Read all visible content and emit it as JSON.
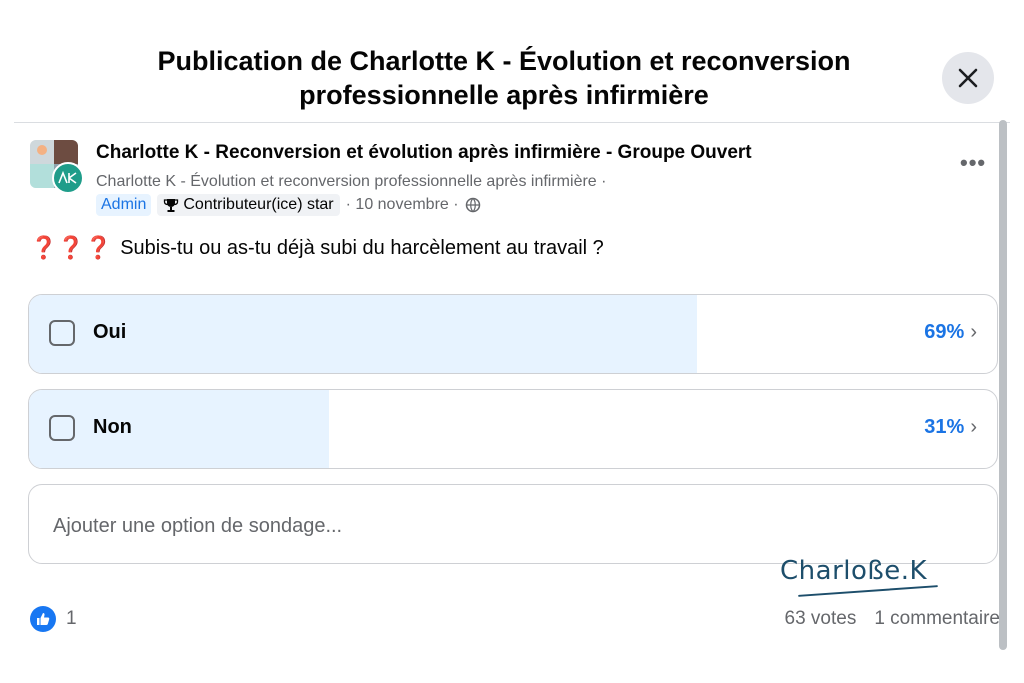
{
  "dialog": {
    "title": "Publication de Charlotte K - Évolution et reconversion professionnelle après infirmière"
  },
  "post": {
    "group_name": "Charlotte K - Reconversion et évolution après infirmière - Groupe Ouvert",
    "author_line": "Charlotte K - Évolution et reconversion professionnelle après infirmière ·",
    "admin_badge": "Admin",
    "star_badge": "Contributeur(ice) star",
    "date": "· 10 novembre ·",
    "question_marks": "❓❓❓",
    "question": "Subis-tu ou as-tu déjà subi du harcèlement au travail ?"
  },
  "poll": {
    "options": [
      {
        "label": "Oui",
        "percent_text": "69%",
        "fraction": 0.69
      },
      {
        "label": "Non",
        "percent_text": "31%",
        "fraction": 0.31
      }
    ],
    "add_option_placeholder": "Ajouter une option de sondage..."
  },
  "footer": {
    "likes": "1",
    "votes": "63 votes",
    "comments": "1 commentaire"
  },
  "watermark": "Charloße.K",
  "icons": {
    "close": "close-icon",
    "more": "more-icon",
    "trophy": "trophy-icon",
    "globe": "globe-icon",
    "like": "thumbs-up-icon"
  },
  "colors": {
    "accent": "#1b74e4",
    "poll_fill": "#e7f3ff",
    "like_blue": "#1877f2"
  }
}
